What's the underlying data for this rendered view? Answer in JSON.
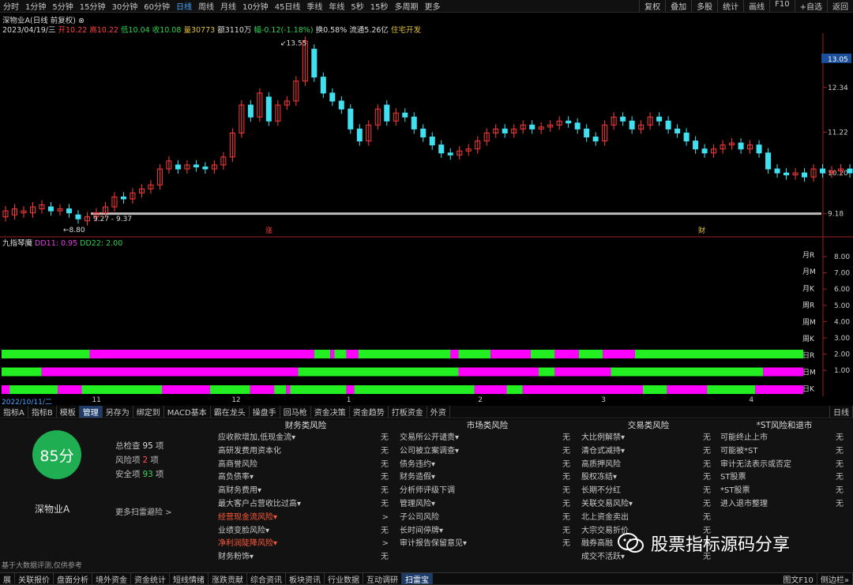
{
  "timeframes": [
    "分时",
    "1分钟",
    "5分钟",
    "15分钟",
    "30分钟",
    "60分钟",
    "日线",
    "周线",
    "月线",
    "10分钟",
    "45日线",
    "季线",
    "年线",
    "5秒",
    "15秒",
    "多周期",
    "更多"
  ],
  "active_timeframe": "日线",
  "right_tools": [
    "复权",
    "叠加",
    "多股",
    "统计",
    "画线",
    "F10",
    "+自选",
    "返回"
  ],
  "info": {
    "name": "深物业A(日线 前复权)",
    "date": "2023/04/19/三",
    "open": "开10.22",
    "high": "高10.22",
    "low": "低10.04",
    "close": "收10.08",
    "vol": "量30773",
    "amount": "额3110万",
    "change": "幅-0.12(-1.18%)",
    "turnover": "换0.58%",
    "float": "流通5.26亿",
    "sector": "住宅开发"
  },
  "price_axis": [
    "13.05",
    "12.34",
    "11.22",
    "10.20",
    "9.18"
  ],
  "price_ylim": [
    8.6,
    13.7
  ],
  "annotations": {
    "high": "13.55",
    "low": "8.80",
    "range": "9.27 - 9.37",
    "mark_zhang": "涨",
    "mark_cai": "财"
  },
  "candles": [
    [
      9.1,
      9.25
    ],
    [
      9.15,
      9.3
    ],
    [
      9.2,
      9.25
    ],
    [
      9.2,
      9.35
    ],
    [
      9.3,
      9.4
    ],
    [
      9.35,
      9.25
    ],
    [
      9.25,
      9.3
    ],
    [
      9.3,
      9.2
    ],
    [
      9.15,
      9.05
    ],
    [
      9.0,
      9.1
    ],
    [
      9.1,
      9.2
    ],
    [
      9.2,
      9.35
    ],
    [
      9.35,
      9.6
    ],
    [
      9.6,
      9.55
    ],
    [
      9.55,
      9.7
    ],
    [
      9.7,
      9.8
    ],
    [
      9.8,
      9.9
    ],
    [
      9.9,
      10.3
    ],
    [
      10.3,
      10.5
    ],
    [
      10.4,
      10.3
    ],
    [
      10.3,
      10.4
    ],
    [
      10.4,
      10.35
    ],
    [
      10.35,
      10.3
    ],
    [
      10.3,
      10.4
    ],
    [
      10.4,
      10.6
    ],
    [
      10.6,
      11.2
    ],
    [
      11.2,
      11.9
    ],
    [
      11.9,
      11.6
    ],
    [
      11.6,
      12.2
    ],
    [
      12.1,
      11.5
    ],
    [
      11.5,
      11.9
    ],
    [
      11.9,
      12.0
    ],
    [
      12.0,
      12.5
    ],
    [
      12.5,
      13.5
    ],
    [
      13.3,
      12.6
    ],
    [
      12.6,
      12.2
    ],
    [
      12.2,
      12.0
    ],
    [
      12.0,
      11.8
    ],
    [
      11.8,
      11.3
    ],
    [
      11.3,
      11.0
    ],
    [
      11.0,
      11.4
    ],
    [
      11.4,
      11.8
    ],
    [
      11.9,
      11.5
    ],
    [
      11.5,
      11.7
    ],
    [
      11.7,
      11.6
    ],
    [
      11.6,
      11.3
    ],
    [
      11.3,
      11.1
    ],
    [
      11.1,
      10.9
    ],
    [
      10.9,
      10.7
    ],
    [
      10.7,
      10.65
    ],
    [
      10.65,
      10.75
    ],
    [
      10.75,
      10.8
    ],
    [
      10.8,
      11.0
    ],
    [
      11.0,
      11.2
    ],
    [
      11.2,
      11.3
    ],
    [
      11.3,
      11.2
    ],
    [
      11.2,
      11.3
    ],
    [
      11.3,
      11.4
    ],
    [
      11.4,
      11.3
    ],
    [
      11.3,
      11.35
    ],
    [
      11.35,
      11.4
    ],
    [
      11.4,
      11.5
    ],
    [
      11.5,
      11.45
    ],
    [
      11.45,
      11.3
    ],
    [
      11.3,
      11.1
    ],
    [
      11.1,
      11.0
    ],
    [
      11.0,
      11.4
    ],
    [
      11.4,
      11.6
    ],
    [
      11.6,
      11.5
    ],
    [
      11.5,
      11.3
    ],
    [
      11.3,
      11.4
    ],
    [
      11.4,
      11.6
    ],
    [
      11.6,
      11.5
    ],
    [
      11.5,
      11.3
    ],
    [
      11.3,
      11.2
    ],
    [
      11.2,
      11.0
    ],
    [
      11.0,
      10.8
    ],
    [
      10.8,
      10.7
    ],
    [
      10.7,
      10.8
    ],
    [
      10.8,
      10.9
    ],
    [
      10.9,
      10.95
    ],
    [
      10.95,
      10.8
    ],
    [
      10.8,
      10.9
    ],
    [
      10.9,
      10.7
    ],
    [
      10.7,
      10.3
    ],
    [
      10.3,
      10.2
    ],
    [
      10.2,
      10.15
    ],
    [
      10.15,
      10.2
    ],
    [
      10.2,
      10.1
    ],
    [
      10.1,
      10.3
    ],
    [
      10.3,
      10.2
    ],
    [
      10.2,
      10.25
    ],
    [
      10.25,
      10.3
    ],
    [
      10.3,
      10.2
    ],
    [
      10.2,
      10.1
    ]
  ],
  "support_line": 9.18,
  "subchart": {
    "title": "九指琴魔",
    "dd11": "DD11: 0.95",
    "dd22": "DD22: 2.00",
    "levels": [
      "8.00",
      "7.00",
      "6.00",
      "5.00",
      "4.00",
      "3.00",
      "2.00",
      "1.00"
    ],
    "labels": [
      "月R",
      "月M",
      "月K",
      "周R",
      "周M",
      "周K",
      "日R",
      "日M",
      "日K"
    ],
    "rows": [
      [
        [
          "g",
          0,
          0.11
        ],
        [
          "m",
          0.11,
          0.39
        ],
        [
          "g",
          0.39,
          0.41
        ],
        [
          "m",
          0.41,
          0.415
        ],
        [
          "g",
          0.415,
          0.43
        ],
        [
          "m",
          0.43,
          0.445
        ],
        [
          "g",
          0.445,
          0.56
        ],
        [
          "m",
          0.56,
          0.57
        ],
        [
          "g",
          0.57,
          0.61
        ],
        [
          "m",
          0.61,
          0.66
        ],
        [
          "g",
          0.66,
          0.69
        ],
        [
          "m",
          0.69,
          0.72
        ],
        [
          "g",
          0.72,
          0.75
        ],
        [
          "m",
          0.75,
          0.79
        ],
        [
          "g",
          0.79,
          1
        ]
      ],
      [
        [
          "g",
          0,
          0.05
        ],
        [
          "m",
          0.05,
          0.37
        ],
        [
          "g",
          0.37,
          0.57
        ],
        [
          "m",
          0.57,
          0.67
        ],
        [
          "g",
          0.67,
          0.69
        ],
        [
          "m",
          0.69,
          0.76
        ],
        [
          "g",
          0.76,
          0.95
        ],
        [
          "m",
          0.95,
          1
        ]
      ],
      [
        [
          "m",
          0,
          0.01
        ],
        [
          "g",
          0.01,
          0.07
        ],
        [
          "m",
          0.07,
          0.1
        ],
        [
          "g",
          0.1,
          0.2
        ],
        [
          "m",
          0.2,
          0.26
        ],
        [
          "g",
          0.26,
          0.31
        ],
        [
          "m",
          0.31,
          0.34
        ],
        [
          "g",
          0.34,
          0.355
        ],
        [
          "m",
          0.355,
          0.36
        ],
        [
          "g",
          0.36,
          0.43
        ],
        [
          "m",
          0.43,
          0.44
        ],
        [
          "g",
          0.44,
          0.59
        ],
        [
          "m",
          0.59,
          0.63
        ],
        [
          "g",
          0.63,
          0.65
        ],
        [
          "m",
          0.65,
          0.8
        ],
        [
          "g",
          0.8,
          0.83
        ],
        [
          "m",
          0.83,
          0.88
        ],
        [
          "g",
          0.88,
          0.94
        ],
        [
          "m",
          0.94,
          1
        ]
      ]
    ]
  },
  "dates": [
    [
      "2022/10/11/二",
      0.0
    ],
    [
      "11",
      0.11
    ],
    [
      "12",
      0.28
    ],
    [
      "1",
      0.42
    ],
    [
      "2",
      0.58
    ],
    [
      "3",
      0.73
    ],
    [
      "4",
      0.91
    ]
  ],
  "tabs": [
    "指标A",
    "指标B",
    "模板",
    "管理",
    "另存为",
    "绑定到",
    "MACD基本",
    "霸在龙头",
    "操盘手",
    "回马枪",
    "资金决策",
    "资金趋势",
    "打板资金",
    "外资"
  ],
  "active_tab": "管理",
  "tab_right": "日线",
  "score": {
    "value": "85分",
    "name": "深物业A",
    "total_label": "总检查",
    "total": "95",
    "risk_label": "风险项",
    "risk": "2",
    "safe_label": "安全项",
    "safe": "93",
    "unit": "项",
    "more": "更多扫雷避险 >"
  },
  "risk_columns": [
    {
      "title": "财务类风险",
      "items": [
        [
          "应收款增加,低现金流▾",
          "无",
          0
        ],
        [
          "高研发费用资本化",
          "无",
          0
        ],
        [
          "高商誉风险",
          "无",
          0
        ],
        [
          "高负债率▾",
          "无",
          0
        ],
        [
          "高财务费用▾",
          "无",
          0
        ],
        [
          "最大客户占营收比过高▾",
          "无",
          0
        ],
        [
          "经营现金流风险▾",
          ">",
          1
        ],
        [
          "业绩变脸风险▾",
          "无",
          0
        ],
        [
          "净利润陡降风险▾",
          ">",
          1
        ],
        [
          "财务粉饰▾",
          "无",
          0
        ]
      ]
    },
    {
      "title": "市场类风险",
      "items": [
        [
          "交易所公开谴责▾",
          "无",
          0
        ],
        [
          "公司被立案调查▾",
          "无",
          0
        ],
        [
          "债务违约▾",
          "无",
          0
        ],
        [
          "财务造假▾",
          "无",
          0
        ],
        [
          "分析师评级下调",
          "无",
          0
        ],
        [
          "管理风险▾",
          "无",
          0
        ],
        [
          "子公司风险",
          "无",
          0
        ],
        [
          "长时间停牌▾",
          "无",
          0
        ],
        [
          "审计报告保留意见▾",
          "无",
          0
        ]
      ]
    },
    {
      "title": "交易类风险",
      "items": [
        [
          "大比例解禁▾",
          "无",
          0
        ],
        [
          "清仓式减持▾",
          "无",
          0
        ],
        [
          "高质押风险",
          "无",
          0
        ],
        [
          "股权冻结▾",
          "无",
          0
        ],
        [
          "长期不分红",
          "无",
          0
        ],
        [
          "关联交易风险▾",
          "无",
          0
        ],
        [
          "北上资金卖出",
          "无",
          0
        ],
        [
          "大宗交易折价",
          "无",
          0
        ],
        [
          "融券高融",
          "无",
          0
        ],
        [
          "成交不活跃▾",
          "无",
          0
        ]
      ]
    },
    {
      "title": "*ST风险和退市",
      "items": [
        [
          "可能终止上市",
          "无",
          0
        ],
        [
          "可能被*ST",
          "无",
          0
        ],
        [
          "审计无法表示或否定",
          "无",
          0
        ],
        [
          "ST股票",
          "无",
          0
        ],
        [
          "*ST股票",
          "无",
          0
        ],
        [
          "进入退市整理",
          "无",
          0
        ]
      ]
    }
  ],
  "disclaimer": "基于大数据评测,仅供参考",
  "bottom_tabs": [
    "展",
    "关联报价",
    "盘面分析",
    "境外资金",
    "资金统计",
    "短线情绪",
    "涨跌贡献",
    "综合资讯",
    "板块资讯",
    "行业数据",
    "互动调研",
    "扫雷宝"
  ],
  "active_bottom": "扫雷宝",
  "bottom_right": [
    "图文F10",
    "侧边栏»"
  ],
  "watermark": "股票指标源码分享",
  "colors": {
    "up": "#ff3b3b",
    "down": "#40e0f0",
    "magenta": "#ff00ff",
    "green": "#22ee22",
    "score": "#1fae52"
  }
}
